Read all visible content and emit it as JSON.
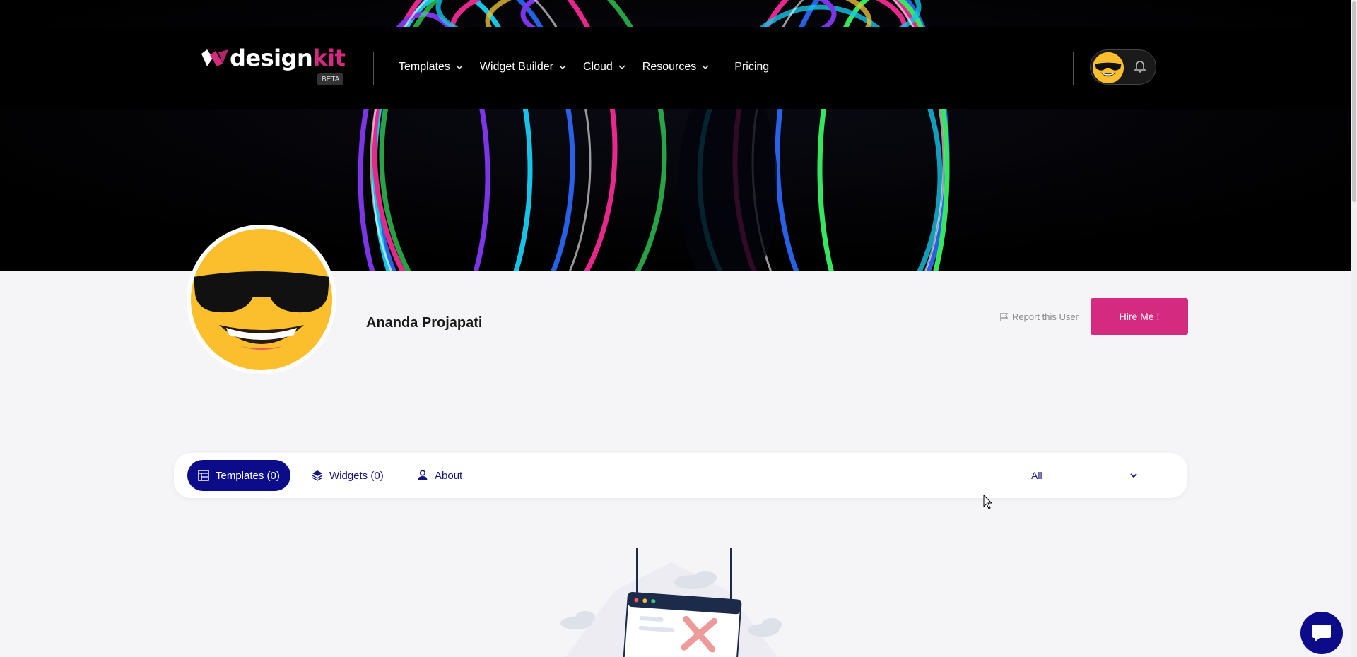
{
  "header": {
    "logo_text_main": "design",
    "logo_text_accent": "kit",
    "beta_badge": "BETA",
    "nav": [
      {
        "label": "Templates",
        "has_dropdown": true
      },
      {
        "label": "Widget Builder",
        "has_dropdown": true
      },
      {
        "label": "Cloud",
        "has_dropdown": true
      },
      {
        "label": "Resources",
        "has_dropdown": true
      },
      {
        "label": "Pricing",
        "has_dropdown": false
      }
    ],
    "icons": [
      "sunglasses-emoji-avatar",
      "bell-icon"
    ]
  },
  "profile": {
    "name": "Ananda Projapati",
    "report_label": "Report this User",
    "hire_button": "Hire Me !"
  },
  "tabs": {
    "items": [
      {
        "label": "Templates (0)",
        "icon": "grid-icon",
        "active": true
      },
      {
        "label": "Widgets (0)",
        "icon": "layers-icon",
        "active": false
      },
      {
        "label": "About",
        "icon": "user-icon",
        "active": false
      }
    ],
    "filter_value": "All"
  },
  "colors": {
    "brand_pink": "#d42a7f",
    "navy": "#0c0c8a",
    "header_bg": "#000000",
    "page_bg": "#f5f5f7"
  }
}
